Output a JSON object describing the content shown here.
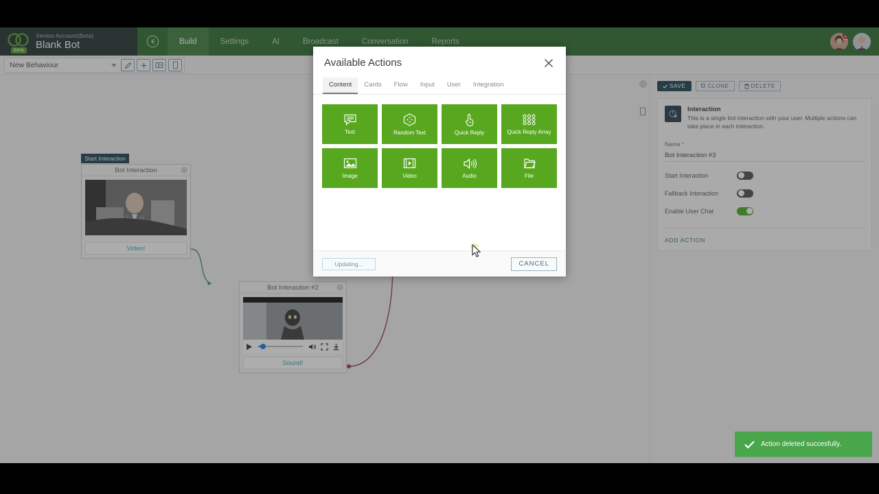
{
  "topbar": {
    "account": "Xenioo Account(Beta)",
    "bot_name": "Blank Bot",
    "beta_badge": "beta",
    "back_icon": "back-arrow-icon",
    "nav": [
      {
        "label": "Build",
        "active": true
      },
      {
        "label": "Settings",
        "active": false
      },
      {
        "label": "AI",
        "active": false
      },
      {
        "label": "Broadcast",
        "active": false
      },
      {
        "label": "Conversation",
        "active": false
      },
      {
        "label": "Reports",
        "active": false
      }
    ],
    "notification_count": "1",
    "bar_color": "#2a6b2c",
    "brand_color": "#1d2e2c"
  },
  "subbar": {
    "behaviour_value": "New Behaviour",
    "buttons": [
      {
        "icon": "pencil-icon"
      },
      {
        "icon": "plus-icon"
      },
      {
        "icon": "grid-icon"
      },
      {
        "icon": "mobile-icon"
      }
    ]
  },
  "canvas": {
    "nodes": [
      {
        "badge": "Start Interaction",
        "title": "Bot Interaction",
        "footer": "Video!",
        "has_player": false
      },
      {
        "badge": "",
        "title": "Bot Interaction #2",
        "footer": "Sound!",
        "has_player": true,
        "player": {
          "play_icon": "play-icon",
          "volume_icon": "volume-icon",
          "fullscreen_icon": "fullscreen-icon",
          "download_icon": "download-icon"
        }
      }
    ],
    "rail": [
      {
        "icon": "gear-icon"
      },
      {
        "icon": "panel-icon"
      }
    ],
    "connector_colors": {
      "primary": "#3f8a85",
      "secondary": "#8e3b3b"
    }
  },
  "modal": {
    "title": "Available Actions",
    "close_icon": "close-icon",
    "tabs": [
      {
        "label": "Content",
        "active": true
      },
      {
        "label": "Cards",
        "active": false
      },
      {
        "label": "Flow",
        "active": false
      },
      {
        "label": "Input",
        "active": false
      },
      {
        "label": "User",
        "active": false
      },
      {
        "label": "Integration",
        "active": false
      }
    ],
    "tiles": [
      {
        "label": "Text",
        "icon": "speech-bubble-icon"
      },
      {
        "label": "Random Text",
        "icon": "dice-icon"
      },
      {
        "label": "Quick Reply",
        "icon": "tap-hand-icon"
      },
      {
        "label": "Quick Reply Array",
        "icon": "dot-grid-icon"
      },
      {
        "label": "Image",
        "icon": "image-icon"
      },
      {
        "label": "Video",
        "icon": "film-icon"
      },
      {
        "label": "Audio",
        "icon": "audio-icon"
      },
      {
        "label": "File",
        "icon": "folder-icon"
      }
    ],
    "updating_label": "Updating...",
    "cancel_label": "CANCEL",
    "tile_color": "#58a81f"
  },
  "right_panel": {
    "save_label": "SAVE",
    "clone_label": "CLONE",
    "delete_label": "DELETE",
    "card_title": "Interaction",
    "card_desc": "This is a single bot interaction with your user. Multiple actions can take place in each interaction.",
    "name_label": "Name",
    "name_required": "*",
    "name_value": "Bot Interaction #3",
    "toggles": [
      {
        "label": "Start Interaction",
        "on": false
      },
      {
        "label": "Fallback Interaction",
        "on": false
      },
      {
        "label": "Enable User Chat",
        "on": true
      }
    ],
    "add_action_label": "ADD ACTION",
    "toggle_on_color": "#45a81b"
  },
  "toast": {
    "message": "Action deleted succesfully.",
    "icon": "check-icon",
    "color": "#49a64a"
  }
}
